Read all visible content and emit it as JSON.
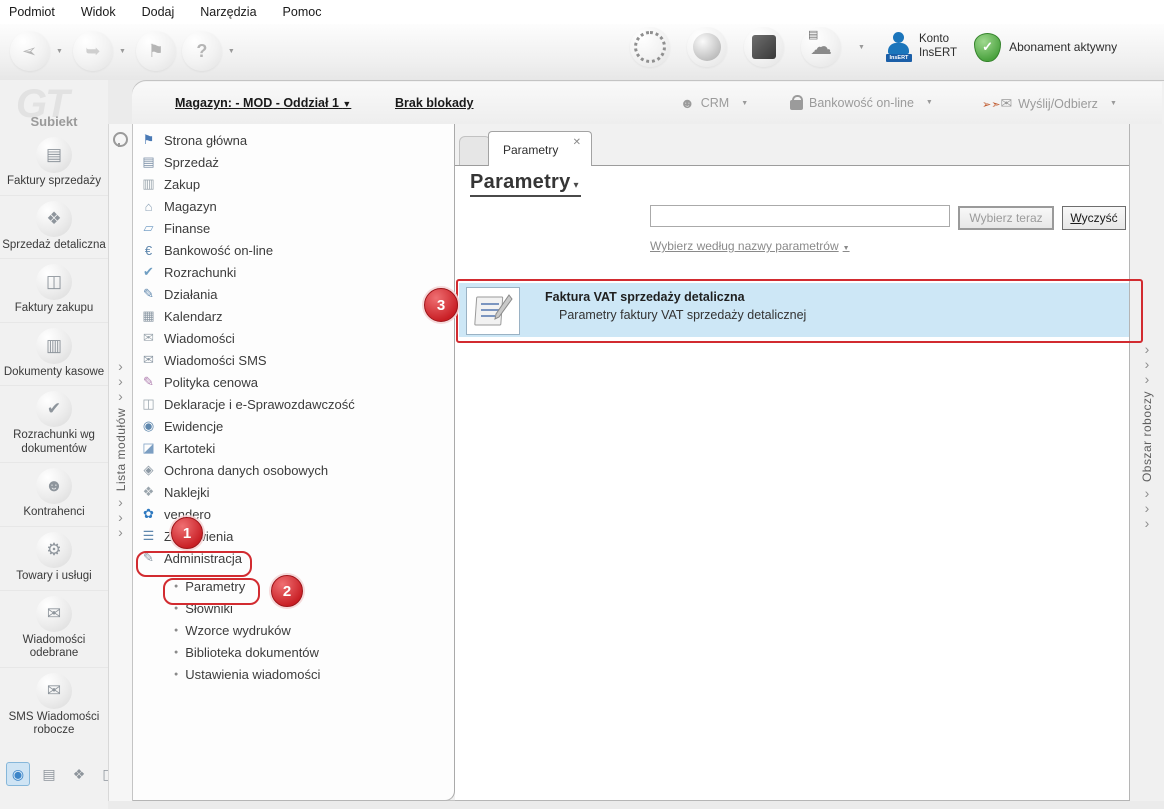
{
  "menubar": {
    "items": [
      "Podmiot",
      "Widok",
      "Dodaj",
      "Narzędzia",
      "Pomoc"
    ]
  },
  "toolbar": {
    "left_icons": [
      "select-arrow-icon",
      "forward-arrow-icon",
      "flag-marker-icon",
      "help-icon"
    ],
    "right_icons": [
      "sync-spinner-icon",
      "globe-icon",
      "cube-icon",
      "cloud-server-icon"
    ],
    "konto_line1": "Konto",
    "konto_line2": "InsERT",
    "insert_badge": "InsERT",
    "subscription_label": "Abonament aktywny"
  },
  "header": {
    "magazyn_link": "Magazyn: - MOD - Oddział 1",
    "lock_link": "Brak blokady",
    "crm_label": "CRM",
    "banking_label": "Bankowość on-line",
    "send_receive_label": "Wyślij/Odbierz"
  },
  "sidebar": {
    "logo": "GT",
    "app_name": "Subiekt",
    "items": [
      {
        "label": "Faktury sprzedaży",
        "icon": "sales-invoices-icon"
      },
      {
        "label": "Sprzedaż detaliczna",
        "icon": "retail-sales-icon"
      },
      {
        "label": "Faktury zakupu",
        "icon": "purchase-invoices-icon"
      },
      {
        "label": "Dokumenty kasowe",
        "icon": "cash-documents-icon"
      },
      {
        "label": "Rozrachunki wg dokumentów",
        "icon": "settlements-by-documents-icon"
      },
      {
        "label": "Kontrahenci",
        "icon": "contractors-icon"
      },
      {
        "label": "Towary i usługi",
        "icon": "goods-services-icon"
      },
      {
        "label": "Wiadomości odebrane",
        "icon": "inbox-messages-icon"
      },
      {
        "label": "SMS Wiadomości robocze",
        "icon": "sms-draft-messages-icon"
      }
    ],
    "bottom_icons": [
      "module-group-main-icon",
      "module-group-sales-icon",
      "module-group-warehouse-icon",
      "module-group-finance-icon"
    ]
  },
  "modules_strip": {
    "label": "Lista modułów"
  },
  "workspace_strip": {
    "label": "Obszar roboczy"
  },
  "modules_panel": {
    "items": [
      {
        "label": "Strona główna",
        "icon": "home-icon"
      },
      {
        "label": "Sprzedaż",
        "icon": "sales-icon"
      },
      {
        "label": "Zakup",
        "icon": "purchase-icon"
      },
      {
        "label": "Magazyn",
        "icon": "warehouse-icon"
      },
      {
        "label": "Finanse",
        "icon": "finance-icon"
      },
      {
        "label": "Bankowość on-line",
        "icon": "online-banking-icon"
      },
      {
        "label": "Rozrachunki",
        "icon": "settlements-icon"
      },
      {
        "label": "Działania",
        "icon": "activities-icon"
      },
      {
        "label": "Kalendarz",
        "icon": "calendar-icon"
      },
      {
        "label": "Wiadomości",
        "icon": "messages-icon"
      },
      {
        "label": "Wiadomości SMS",
        "icon": "sms-messages-icon"
      },
      {
        "label": "Polityka cenowa",
        "icon": "price-policy-icon"
      },
      {
        "label": "Deklaracje i e-Sprawozdawczość",
        "icon": "declarations-icon"
      },
      {
        "label": "Ewidencje",
        "icon": "records-icon"
      },
      {
        "label": "Kartoteki",
        "icon": "card-files-icon"
      },
      {
        "label": "Ochrona danych osobowych",
        "icon": "personal-data-protection-icon"
      },
      {
        "label": "Naklejki",
        "icon": "stickers-icon"
      },
      {
        "label": "vendero",
        "icon": "vendero-icon"
      },
      {
        "label": "Zestawienia",
        "icon": "reports-icon"
      },
      {
        "label": "Administracja",
        "icon": "administration-icon"
      }
    ],
    "admin_children": [
      "Parametry",
      "Słowniki",
      "Wzorce wydruków",
      "Biblioteka dokumentów",
      "Ustawienia wiadomości"
    ]
  },
  "workspace": {
    "tab_label": "Parametry",
    "page_title": "Parametry",
    "search_value": "",
    "select_button": "Wybierz teraz",
    "clear_button_initial": "W",
    "clear_button_rest": "yczyść",
    "filter_link": "Wybierz według nazwy parametrów",
    "result": {
      "title": "Faktura VAT sprzedaży detaliczna",
      "description": "Parametry faktury VAT sprzedaży detalicznej"
    }
  },
  "annotations": {
    "step1": "1",
    "step2": "2",
    "step3": "3"
  },
  "colors": {
    "highlight_row": "#cde7f6",
    "annotation_red": "#d22b30",
    "accent_blue": "#1b75bb",
    "shield_green": "#4aa23e"
  }
}
